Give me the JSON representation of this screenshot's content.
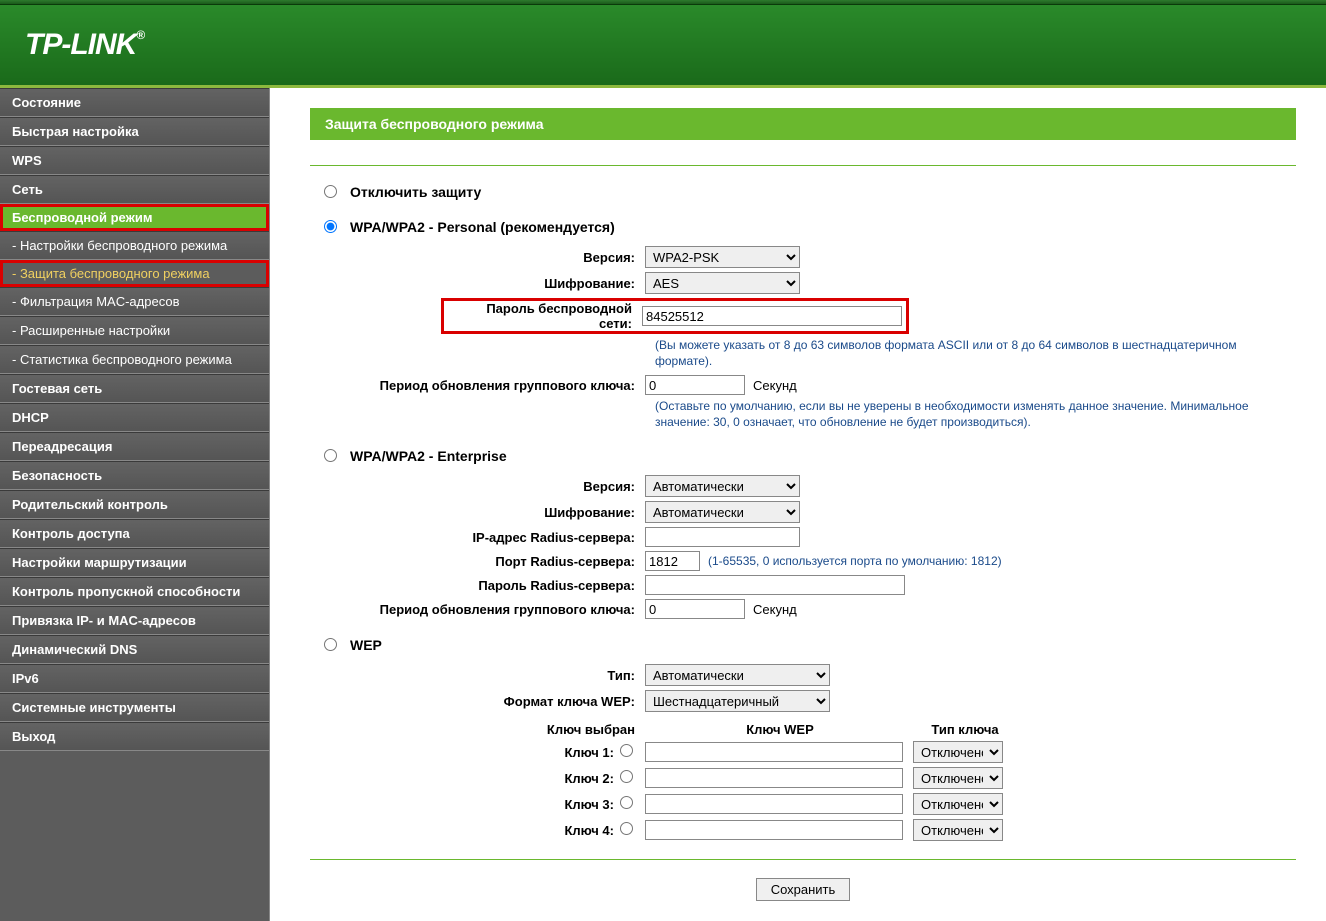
{
  "logo": "TP-LINK",
  "sidebar": [
    {
      "label": "Состояние",
      "cls": ""
    },
    {
      "label": "Быстрая настройка",
      "cls": ""
    },
    {
      "label": "WPS",
      "cls": ""
    },
    {
      "label": "Сеть",
      "cls": ""
    },
    {
      "label": "Беспроводной режим",
      "cls": "active-green"
    },
    {
      "label": "- Настройки беспроводного режима",
      "cls": "sub"
    },
    {
      "label": "- Защита беспроводного режима",
      "cls": "sub-active"
    },
    {
      "label": "- Фильтрация MAC-адресов",
      "cls": "sub"
    },
    {
      "label": "- Расширенные настройки",
      "cls": "sub"
    },
    {
      "label": "- Статистика беспроводного режима",
      "cls": "sub"
    },
    {
      "label": "Гостевая сеть",
      "cls": ""
    },
    {
      "label": "DHCP",
      "cls": ""
    },
    {
      "label": "Переадресация",
      "cls": ""
    },
    {
      "label": "Безопасность",
      "cls": ""
    },
    {
      "label": "Родительский контроль",
      "cls": ""
    },
    {
      "label": "Контроль доступа",
      "cls": ""
    },
    {
      "label": "Настройки маршрутизации",
      "cls": ""
    },
    {
      "label": "Контроль пропускной способности",
      "cls": ""
    },
    {
      "label": "Привязка IP- и MAC-адресов",
      "cls": ""
    },
    {
      "label": "Динамический DNS",
      "cls": ""
    },
    {
      "label": "IPv6",
      "cls": ""
    },
    {
      "label": "Системные инструменты",
      "cls": ""
    },
    {
      "label": "Выход",
      "cls": ""
    }
  ],
  "page": {
    "title": "Защита беспроводного режима",
    "disable_label": "Отключить защиту",
    "save": "Сохранить"
  },
  "wpa_personal": {
    "title": "WPA/WPA2 - Personal (рекомендуется)",
    "version_label": "Версия:",
    "version_value": "WPA2-PSK",
    "encryption_label": "Шифрование:",
    "encryption_value": "AES",
    "password_label": "Пароль беспроводной сети:",
    "password_value": "84525512",
    "password_note": "(Вы можете указать от 8 до 63 символов формата ASCII или от 8 до 64 символов в шестнадцатеричном формате).",
    "gk_label": "Период обновления группового ключа:",
    "gk_value": "0",
    "gk_unit": "Секунд",
    "gk_note": "(Оставьте по умолчанию, если вы не уверены в необходимости изменять данное значение. Минимальное значение: 30, 0 означает, что обновление не будет производиться)."
  },
  "wpa_ent": {
    "title": "WPA/WPA2 - Enterprise",
    "version_label": "Версия:",
    "version_value": "Автоматически",
    "encryption_label": "Шифрование:",
    "encryption_value": "Автоматически",
    "radius_ip_label": "IP-адрес Radius-сервера:",
    "radius_ip_value": "",
    "radius_port_label": "Порт Radius-сервера:",
    "radius_port_value": "1812",
    "radius_port_note": "(1-65535, 0 используется порта по умолчанию: 1812)",
    "radius_pw_label": "Пароль Radius-сервера:",
    "radius_pw_value": "",
    "gk_label": "Период обновления группового ключа:",
    "gk_value": "0",
    "gk_unit": "Секунд"
  },
  "wep": {
    "title": "WEP",
    "type_label": "Тип:",
    "type_value": "Автоматически",
    "format_label": "Формат ключа WEP:",
    "format_value": "Шестнадцатеричный",
    "hdr_selected": "Ключ выбран",
    "hdr_key": "Ключ WEP",
    "hdr_type": "Тип ключа",
    "keys": [
      {
        "label": "Ключ 1:",
        "val": "",
        "type": "Отключено"
      },
      {
        "label": "Ключ 2:",
        "val": "",
        "type": "Отключено"
      },
      {
        "label": "Ключ 3:",
        "val": "",
        "type": "Отключено"
      },
      {
        "label": "Ключ 4:",
        "val": "",
        "type": "Отключено"
      }
    ]
  }
}
